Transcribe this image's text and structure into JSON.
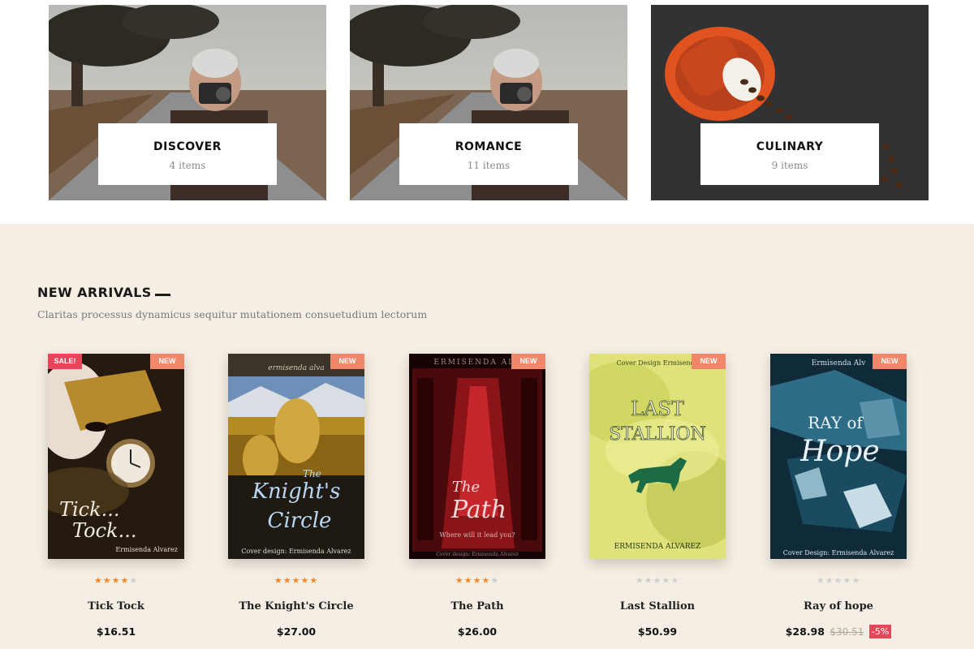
{
  "categories": [
    {
      "title": "DISCOVER",
      "count": "4 items"
    },
    {
      "title": "ROMANCE",
      "count": "11 items"
    },
    {
      "title": "CULINARY",
      "count": "9 items"
    }
  ],
  "new_arrivals": {
    "title": "NEW ARRIVALS",
    "subtitle": "Claritas processus dynamicus sequitur mutationem consuetudium lectorum",
    "badge_new": "NEW",
    "badge_sale": "SALE!",
    "products": [
      {
        "name": "Tick Tock",
        "price": "$16.51",
        "rating": 4,
        "rating_max": 5,
        "sale": true,
        "cover": {
          "title_line1": "Tick...",
          "title_line2": "Tock...",
          "author": "Ermisenda Alvarez"
        }
      },
      {
        "name": "The Knight's Circle",
        "price": "$27.00",
        "rating": 5,
        "rating_max": 5,
        "sale": false,
        "cover": {
          "top_text": "ermisenda alva",
          "title_line1": "The",
          "title_line2": "Knight's",
          "title_line3": "Circle",
          "footer": "Cover design: Ermisenda Alvarez"
        }
      },
      {
        "name": "The Path",
        "price": "$26.00",
        "rating": 4,
        "rating_max": 5,
        "sale": false,
        "cover": {
          "top_text": "ERMISENDA ALV",
          "title_line1": "The",
          "title_line2": "Path",
          "tagline": "Where will it lead you?",
          "footer": "Cover design: Ermisenda Alvarez"
        }
      },
      {
        "name": "Last Stallion",
        "price": "$50.99",
        "rating": 0,
        "rating_max": 5,
        "sale": false,
        "cover": {
          "top_text": "Cover Design Ermisenda",
          "title_line1": "LAST",
          "title_line2": "STALLION",
          "author": "ERMISENDA ALVAREZ"
        }
      },
      {
        "name": "Ray of hope",
        "price": "$28.98",
        "old_price": "$30.51",
        "discount": "-5%",
        "rating": 0,
        "rating_max": 5,
        "sale": false,
        "cover": {
          "top_text": "Ermisenda Alv",
          "title_line1": "RAY of",
          "title_line2": "Hope",
          "footer": "Cover Design: Ermisenda Alvarez"
        }
      }
    ]
  },
  "colors": {
    "section_background": "#f5eee4",
    "badge_new": "#f0876b",
    "badge_sale": "#e8455a",
    "star_on": "#f28a2a",
    "star_off": "#cfcfcf"
  }
}
